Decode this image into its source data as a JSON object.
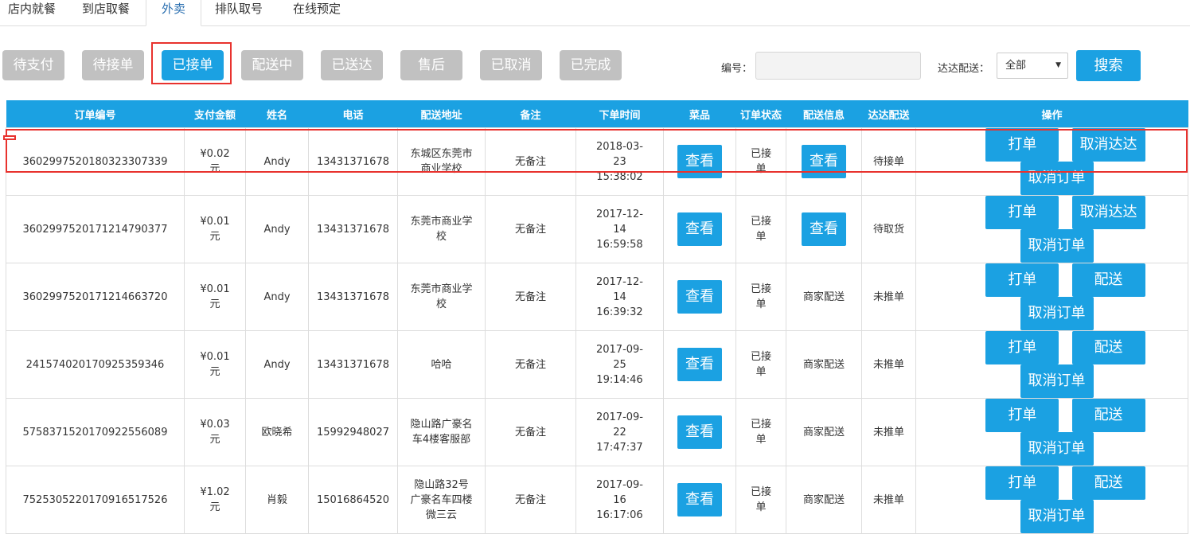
{
  "tabs": [
    "店内就餐",
    "到店取餐",
    "外卖",
    "排队取号",
    "在线预定"
  ],
  "active_tab": 2,
  "filters": [
    "待支付",
    "待接单",
    "已接单",
    "配送中",
    "已送达",
    "售后",
    "已取消",
    "已完成"
  ],
  "active_filter": 2,
  "search": {
    "order_label": "编号：",
    "order_value": "",
    "dada_label": "达达配送：",
    "dada_selected": "全部",
    "search_button": "搜索"
  },
  "table": {
    "headers": [
      "订单编号",
      "支付金额",
      "姓名",
      "电话",
      "配送地址",
      "备注",
      "下单时间",
      "菜品",
      "订单状态",
      "配送信息",
      "达达配送",
      "操作"
    ],
    "rows": [
      {
        "order_no": "360299752018032330733​9",
        "amount_lines": [
          "¥0.02",
          "元"
        ],
        "name": "Andy",
        "phone": "13431371678",
        "address_lines": [
          "东城区东莞市",
          "商业学校"
        ],
        "remark": "无备注",
        "time_lines": [
          "2018-03-",
          "23",
          "15:38:02"
        ],
        "dish_btn": "查看",
        "status_lines": [
          "已接",
          "单"
        ],
        "delivery_type": "button",
        "delivery_info": "查看",
        "dada_status": "待接单",
        "op1": "打单",
        "op2": "取消达达",
        "op3": "取消订单"
      },
      {
        "order_no": "360299752017121479037​7",
        "amount_lines": [
          "¥0.01",
          "元"
        ],
        "name": "Andy",
        "phone": "13431371678",
        "address_lines": [
          "东莞市商业学",
          "校"
        ],
        "remark": "无备注",
        "time_lines": [
          "2017-12-",
          "14",
          "16:59:58"
        ],
        "dish_btn": "查看",
        "status_lines": [
          "已接",
          "单"
        ],
        "delivery_type": "button",
        "delivery_info": "查看",
        "dada_status": "待取货",
        "op1": "打单",
        "op2": "取消达达",
        "op3": "取消订单"
      },
      {
        "order_no": "360299752017121466372​0",
        "amount_lines": [
          "¥0.01",
          "元"
        ],
        "name": "Andy",
        "phone": "13431371678",
        "address_lines": [
          "东莞市商业学",
          "校"
        ],
        "remark": "无备注",
        "time_lines": [
          "2017-12-",
          "14",
          "16:39:32"
        ],
        "dish_btn": "查看",
        "status_lines": [
          "已接",
          "单"
        ],
        "delivery_type": "text",
        "delivery_info": "商家配送",
        "dada_status": "未推单",
        "op1": "打单",
        "op2": "配送",
        "op3": "取消订单"
      },
      {
        "order_no": "24157402017092535934​6",
        "amount_lines": [
          "¥0.01",
          "元"
        ],
        "name": "Andy",
        "phone": "13431371678",
        "address_lines": [
          "哈哈"
        ],
        "remark": "无备注",
        "time_lines": [
          "2017-09-",
          "25",
          "19:14:46"
        ],
        "dish_btn": "查看",
        "status_lines": [
          "已接",
          "单"
        ],
        "delivery_type": "text",
        "delivery_info": "商家配送",
        "dada_status": "未推单",
        "op1": "打单",
        "op2": "配送",
        "op3": "取消订单"
      },
      {
        "order_no": "575837152017092255608​9",
        "amount_lines": [
          "¥0.03",
          "元"
        ],
        "name": "欧晓希",
        "phone": "15992948027",
        "address_lines": [
          "隐山路广豪名",
          "车4楼客服部"
        ],
        "remark": "无备注",
        "time_lines": [
          "2017-09-",
          "22",
          "17:47:37"
        ],
        "dish_btn": "查看",
        "status_lines": [
          "已接",
          "单"
        ],
        "delivery_type": "text",
        "delivery_info": "商家配送",
        "dada_status": "未推单",
        "op1": "打单",
        "op2": "配送",
        "op3": "取消订单"
      },
      {
        "order_no": "752530522017091651752​6",
        "amount_lines": [
          "¥1.02",
          "元"
        ],
        "name": "肖毅",
        "phone": "15016864520",
        "address_lines": [
          "隐山路32号",
          "广豪名车四楼",
          "微三云"
        ],
        "remark": "无备注",
        "time_lines": [
          "2017-09-",
          "16",
          "16:17:06"
        ],
        "dish_btn": "查看",
        "status_lines": [
          "已接",
          "单"
        ],
        "delivery_type": "text",
        "delivery_info": "商家配送",
        "dada_status": "未推单",
        "op1": "打单",
        "op2": "配送",
        "op3": "取消订单"
      }
    ]
  },
  "colors": {
    "accent": "#1ba1e2",
    "inactive": "#c1c1c1",
    "highlight": "#e8322e"
  }
}
